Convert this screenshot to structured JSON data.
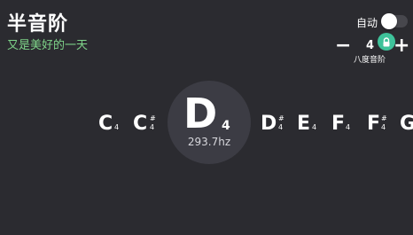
{
  "header": {
    "title": "半音阶",
    "subtitle": "又是美好的一天"
  },
  "controls": {
    "auto_label": "自动",
    "auto_enabled": false,
    "minus_label": "−",
    "plus_label": "+",
    "octave_value": "4",
    "octave_label": "八度音阶",
    "lock_icon": "lock-icon",
    "lock_color": "#3ec29a"
  },
  "current_note": {
    "letter": "D",
    "octave": "4",
    "frequency": "293.7hz"
  },
  "notes": [
    {
      "letter": "C",
      "sharp": "",
      "octave": "4"
    },
    {
      "letter": "C",
      "sharp": "#",
      "octave": "4"
    },
    {
      "letter": "D",
      "sharp": "#",
      "octave": "4"
    },
    {
      "letter": "E",
      "sharp": "",
      "octave": "4"
    },
    {
      "letter": "F",
      "sharp": "",
      "octave": "4"
    },
    {
      "letter": "F",
      "sharp": "#",
      "octave": "4"
    },
    {
      "letter": "G",
      "sharp": "",
      "octave": ""
    }
  ],
  "colors": {
    "background": "#2b2b30",
    "accent": "#7fd58a",
    "circle": "#3c3c44"
  }
}
